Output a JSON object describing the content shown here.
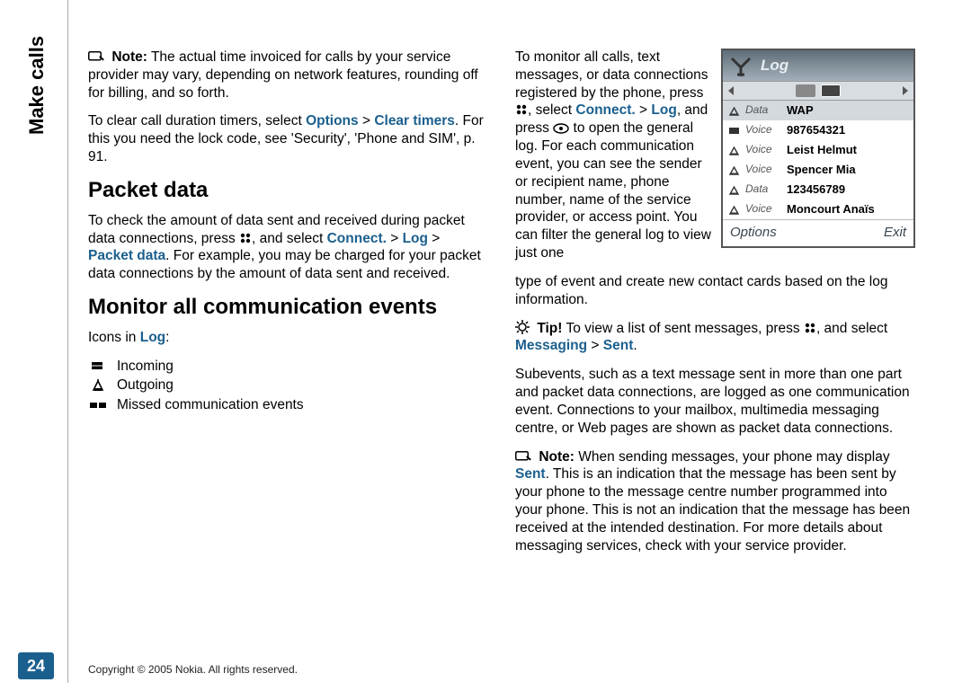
{
  "side_title": "Make calls",
  "page_number": "24",
  "footer": "Copyright © 2005 Nokia. All rights reserved.",
  "left": {
    "note1_label": "Note:",
    "note1_text": " The actual time invoiced for calls by your service provider may vary, depending on network features, rounding off for billing, and so forth.",
    "clear_pre": "To clear call duration timers, select ",
    "clear_options": "Options",
    "gt": " > ",
    "clear_timers": "Clear timers",
    "clear_post": ". For this you need the lock code, see 'Security', 'Phone and SIM', p. 91.",
    "h_packet": "Packet data",
    "packet_pre": "To check the amount of data sent and received during packet data connections, press ",
    "packet_post1": ", and select ",
    "connect": "Connect.",
    "log": "Log",
    "packet_data": "Packet data",
    "packet_post2": ". For example, you may be charged for your packet data connections by the amount of data sent and received.",
    "h_monitor": "Monitor all communication events",
    "icons_in": "Icons in ",
    "log_link": "Log",
    "colon": ":",
    "incoming": "Incoming",
    "outgoing": "Outgoing",
    "missed": "Missed communication events"
  },
  "right": {
    "para1_pre": "To monitor all calls, text messages, or data connections registered by the phone, press ",
    "para1_mid1": ", select ",
    "connect": "Connect.",
    "gt": " > ",
    "log": "Log",
    "para1_mid2": ", and press ",
    "para1_mid3": " to open the general log. For each communication event, you can see the sender or recipient name, phone number, name of the service provider, or access point. You can filter the general log to view just one ",
    "para1_cont": "type of event and create new contact cards based on the log information.",
    "tip_label": "Tip!",
    "tip_pre": " To view a list of sent messages, press ",
    "tip_mid": ", and select ",
    "messaging": "Messaging",
    "sent": "Sent",
    "tip_post": ".",
    "para2": "Subevents, such as a text message sent in more than one part and packet data connections, are logged as one communication event. Connections to your mailbox, multimedia messaging centre, or Web pages are shown as packet data connections.",
    "note2_label": "Note:",
    "note2_pre": " When sending messages, your phone may display ",
    "note2_sent": "Sent",
    "note2_post": ". This is an indication that the message has been sent by your phone to the message centre number programmed into your phone. This is not an indication that the message has been received at the intended destination. For more details about messaging services, check with your service provider."
  },
  "phone": {
    "title": "Log",
    "rows": [
      {
        "type": "Data",
        "val": "WAP",
        "dir": "out"
      },
      {
        "type": "Voice",
        "val": "987654321",
        "dir": "in"
      },
      {
        "type": "Voice",
        "val": "Leist Helmut",
        "dir": "out"
      },
      {
        "type": "Voice",
        "val": "Spencer Mia",
        "dir": "out"
      },
      {
        "type": "Data",
        "val": "123456789",
        "dir": "out"
      },
      {
        "type": "Voice",
        "val": "Moncourt Anaïs",
        "dir": "out"
      }
    ],
    "soft_left": "Options",
    "soft_right": "Exit"
  }
}
